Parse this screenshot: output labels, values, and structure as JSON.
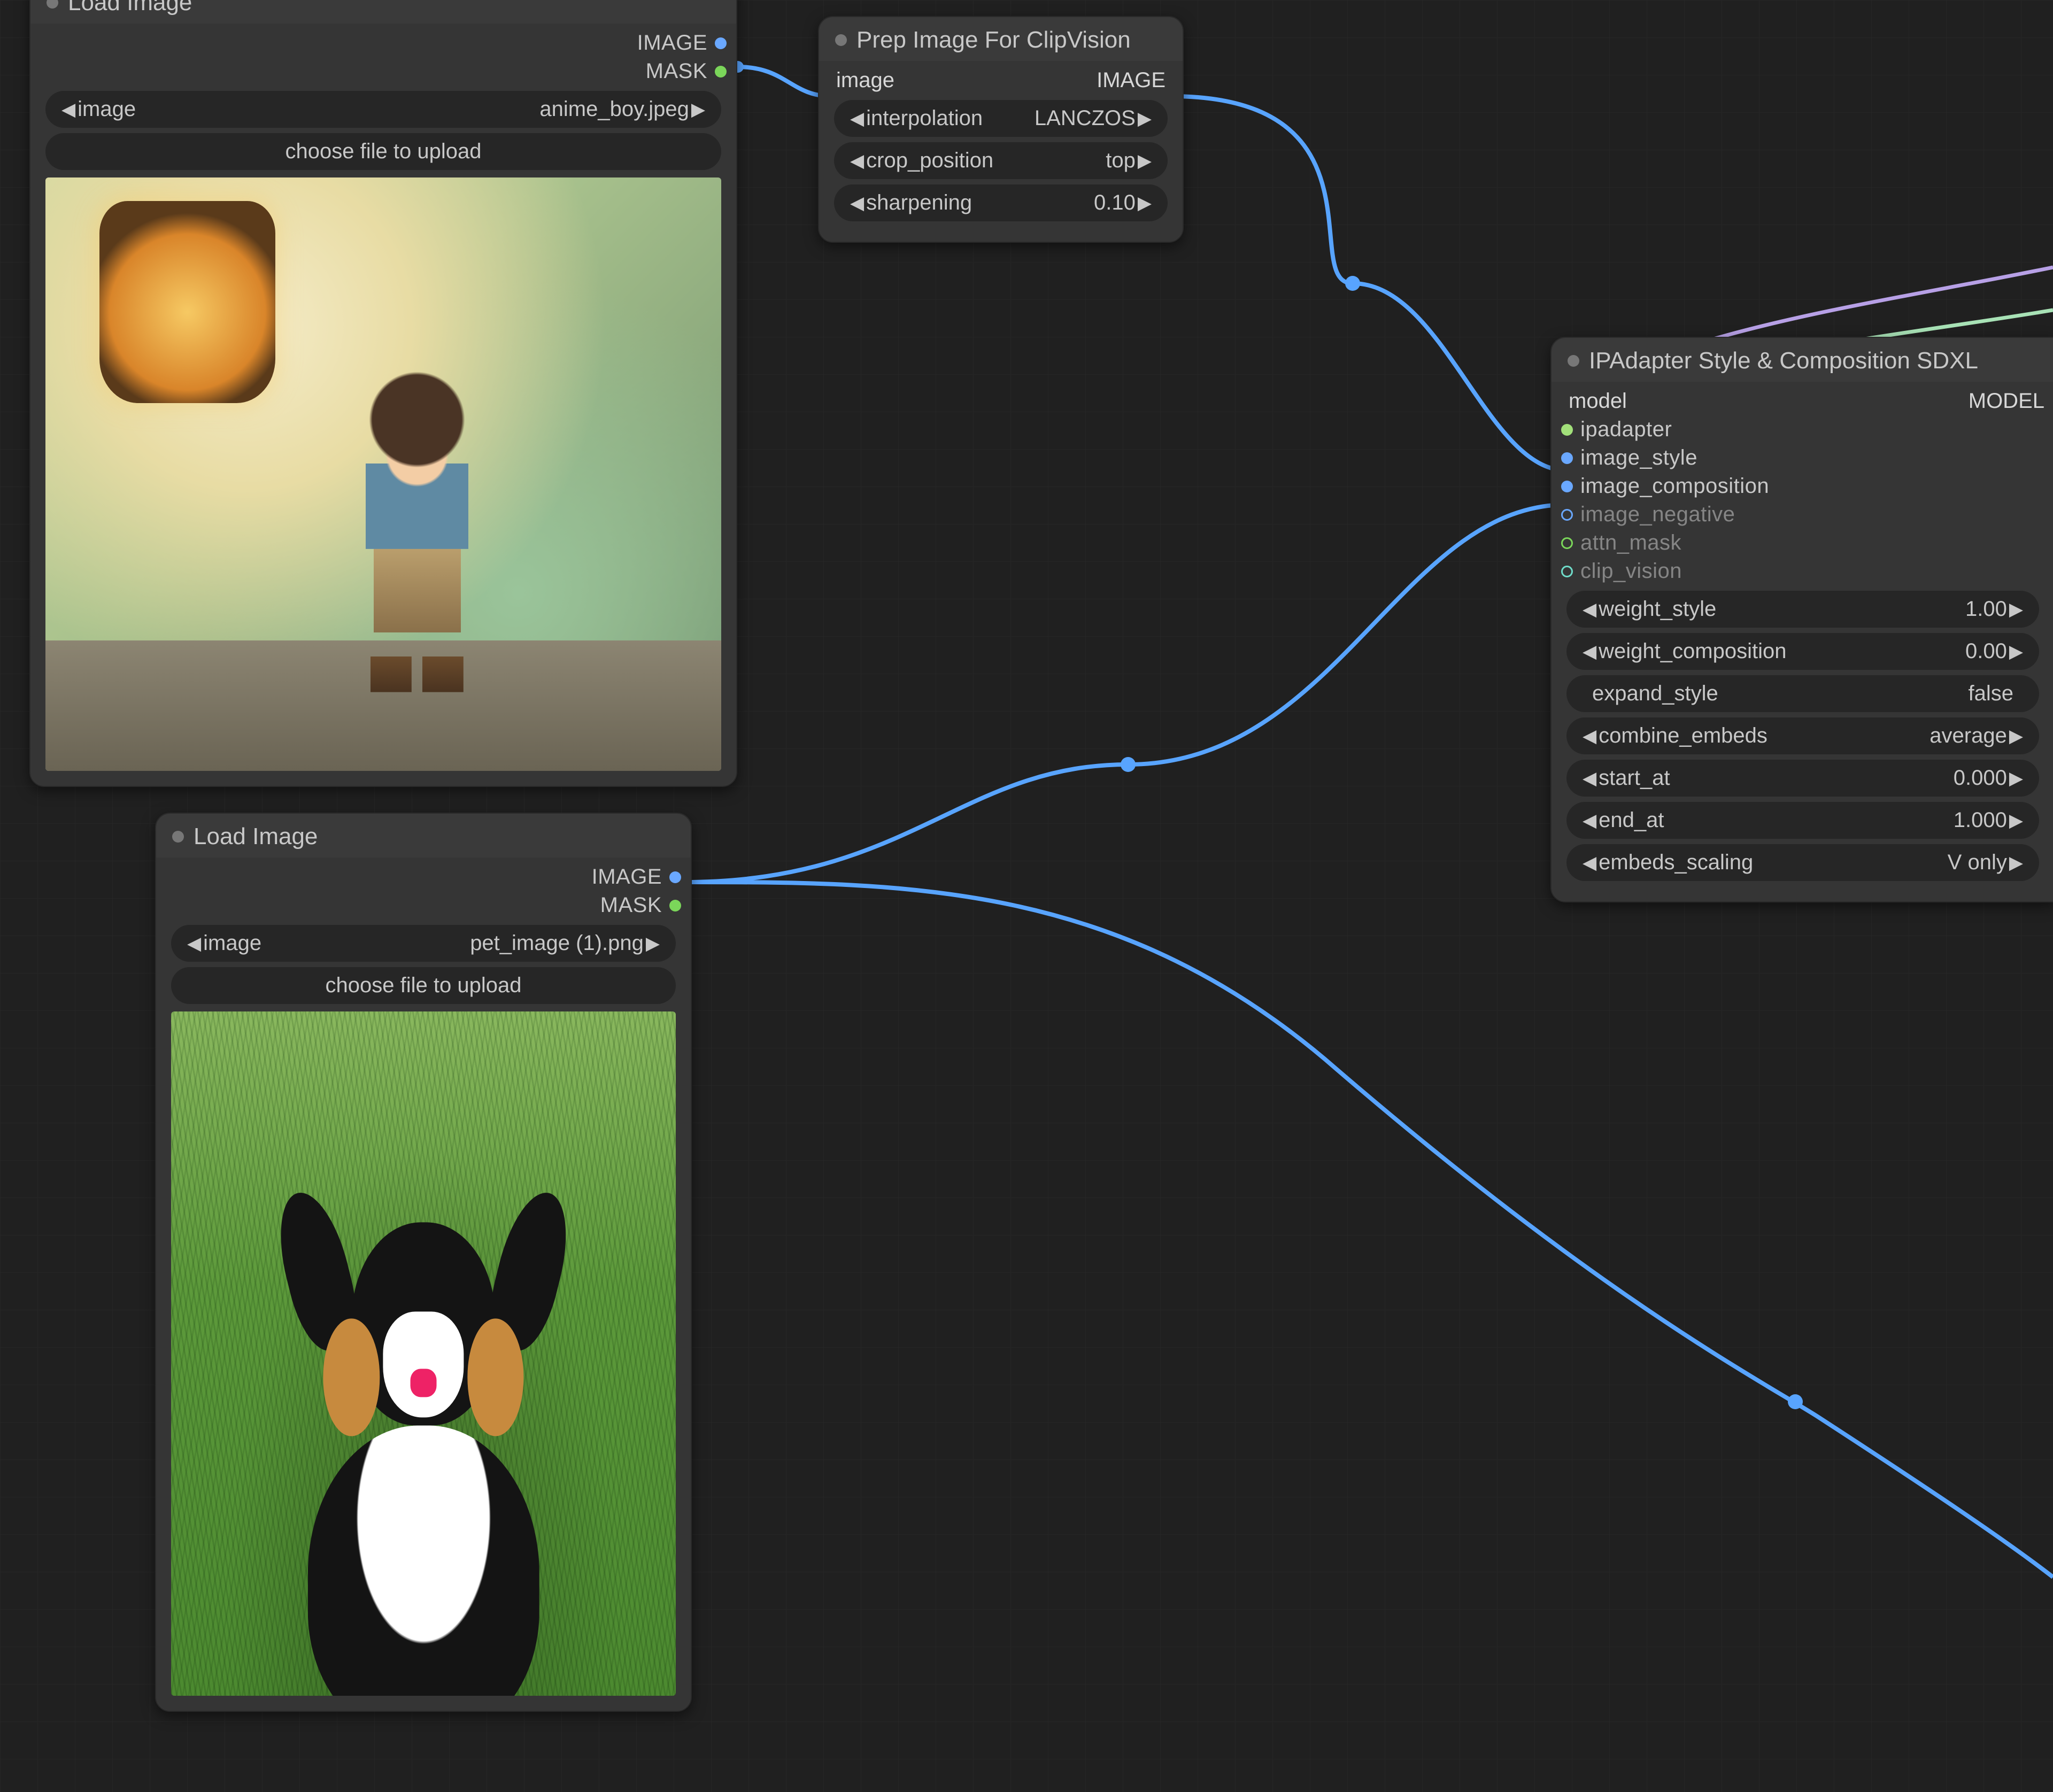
{
  "nodes": {
    "loadImage1": {
      "title": "Load Image",
      "outputs": {
        "image": "IMAGE",
        "mask": "MASK"
      },
      "widgets": {
        "image_label": "image",
        "image_value": "anime_boy.jpeg",
        "upload_label": "choose file to upload"
      }
    },
    "loadImage2": {
      "title": "Load Image",
      "outputs": {
        "image": "IMAGE",
        "mask": "MASK"
      },
      "widgets": {
        "image_label": "image",
        "image_value": "pet_image (1).png",
        "upload_label": "choose file to upload"
      }
    },
    "prepImage": {
      "title": "Prep Image For ClipVision",
      "inputs": {
        "image": "image"
      },
      "outputs": {
        "image": "IMAGE"
      },
      "widgets": {
        "interpolation_label": "interpolation",
        "interpolation_value": "LANCZOS",
        "crop_label": "crop_position",
        "crop_value": "top",
        "sharpening_label": "sharpening",
        "sharpening_value": "0.10"
      }
    },
    "ipadapter": {
      "title": "IPAdapter Style & Composition SDXL",
      "inputs": {
        "model": "model",
        "ipadapter": "ipadapter",
        "image_style": "image_style",
        "image_composition": "image_composition",
        "image_negative": "image_negative",
        "attn_mask": "attn_mask",
        "clip_vision": "clip_vision"
      },
      "outputs": {
        "model": "MODEL"
      },
      "widgets": {
        "weight_style_label": "weight_style",
        "weight_style_value": "1.00",
        "weight_composition_label": "weight_composition",
        "weight_composition_value": "0.00",
        "expand_style_label": "expand_style",
        "expand_style_value": "false",
        "combine_embeds_label": "combine_embeds",
        "combine_embeds_value": "average",
        "start_at_label": "start_at",
        "start_at_value": "0.000",
        "end_at_label": "end_at",
        "end_at_value": "1.000",
        "embeds_scaling_label": "embeds_scaling",
        "embeds_scaling_value": "V only"
      }
    }
  }
}
